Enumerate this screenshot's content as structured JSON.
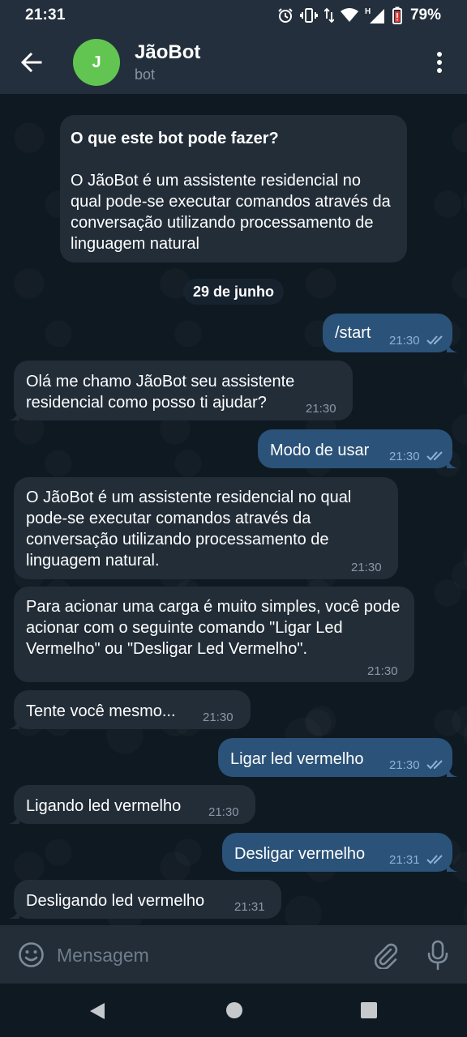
{
  "status_bar": {
    "time": "21:31",
    "battery": "79%",
    "icons": [
      "alarm-icon",
      "vibrate-icon",
      "data-arrows-icon",
      "wifi-icon",
      "signal-h-icon",
      "battery-icon"
    ],
    "network_type": "H"
  },
  "header": {
    "avatar_letter": "J",
    "avatar_color": "#62c552",
    "title": "JãoBot",
    "subtitle": "bot",
    "icons": [
      "back-arrow-icon",
      "more-vertical-icon"
    ]
  },
  "info_card": {
    "title": "O que este bot pode fazer?",
    "body": "O JãoBot é um assistente residencial no qual pode-se executar comandos através da conversação utilizando processamento de linguagem natural"
  },
  "date_separator": "29 de junho",
  "messages": [
    {
      "direction": "out",
      "text": "/start",
      "time": "21:30",
      "read": true
    },
    {
      "direction": "in",
      "text": "Olá me chamo JãoBot seu assistente residencial como posso ti ajudar?",
      "time": "21:30"
    },
    {
      "direction": "out",
      "text": "Modo de usar",
      "time": "21:30",
      "read": true
    },
    {
      "direction": "in",
      "text": "O JãoBot é um assistente residencial no qual pode-se executar comandos através da conversação utilizando processamento de linguagem natural.",
      "time": "21:30"
    },
    {
      "direction": "in",
      "text": "Para acionar uma carga é muito simples, você pode acionar com o seguinte comando \"Ligar Led Vermelho\" ou \"Desligar Led Vermelho\".",
      "time": "21:30"
    },
    {
      "direction": "in",
      "text": "Tente você mesmo...",
      "time": "21:30"
    },
    {
      "direction": "out",
      "text": "Ligar led vermelho",
      "time": "21:30",
      "read": true
    },
    {
      "direction": "in",
      "text": "Ligando led vermelho",
      "time": "21:30"
    },
    {
      "direction": "out",
      "text": "Desligar vermelho",
      "time": "21:31",
      "read": true
    },
    {
      "direction": "in",
      "text": "Desligando led vermelho",
      "time": "21:31"
    }
  ],
  "input": {
    "placeholder": "Mensagem",
    "icons": [
      "emoji-icon",
      "attach-icon",
      "mic-icon"
    ]
  },
  "nav_bar": {
    "icons": [
      "nav-back-icon",
      "nav-home-icon",
      "nav-recents-icon"
    ]
  },
  "colors": {
    "header_bg": "#232f3c",
    "chat_bg": "#0f1922",
    "incoming_bubble": "#222d38",
    "outgoing_bubble": "#2b5278",
    "read_ticks": "#8eb2d6"
  }
}
